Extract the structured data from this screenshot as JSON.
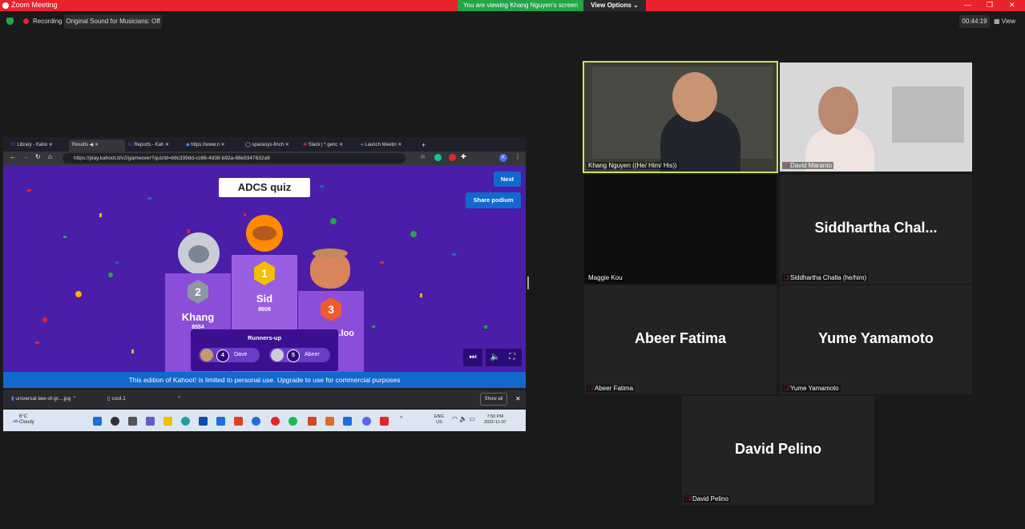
{
  "window": {
    "title": "Zoom Meeting",
    "viewing_banner": "You are viewing Khang Nguyen's screen",
    "view_options": "View Options ⌄",
    "controls": [
      "—",
      "❐",
      "✕"
    ]
  },
  "toolbar": {
    "recording": "Recording",
    "original_sound": "Original Sound for Musicians: Off",
    "timer": "00:44:19",
    "view": "View"
  },
  "browser": {
    "tabs": [
      "Library - Kaho",
      "Results",
      "Reports - Kah",
      "https://www.n",
      "spacesys-finch",
      "Slack | * genc",
      "Launch Meetin"
    ],
    "url": "https://play.kahoot.it/v2/gameover?quizId=b9c339dd-cc66-4d38-b92a-68e9347632a9",
    "new_tab": "+"
  },
  "kahoot": {
    "quiz_title": "ADCS quiz",
    "next": "Next",
    "share_podium": "Share podium",
    "podium": [
      {
        "rank": "2",
        "name": "Khang",
        "score": "8554"
      },
      {
        "rank": "1",
        "name": "Sid",
        "score": "8608"
      },
      {
        "rank": "3",
        "name": "...loo",
        "score": ""
      }
    ],
    "runners_up_title": "Runners-up",
    "runners_up": [
      {
        "rank": "4",
        "name": "Dave"
      },
      {
        "rank": "5",
        "name": "Abeer"
      }
    ],
    "banner": "This edition of Kahoot! is limited to personal use. Upgrade to use for commercial purposes"
  },
  "downloads": {
    "items": [
      "universal-law-of-gr....jpg",
      "cool.1"
    ],
    "show_all": "Show all"
  },
  "taskbar": {
    "temp": "6°C",
    "weather": "Cloudy",
    "lang": "ENG",
    "region": "US",
    "time": "7:50 PM",
    "date": "2022-11-07"
  },
  "participants": [
    {
      "name": "Khang Nguyen ((He/ Him/ His))",
      "display": "",
      "video": true
    },
    {
      "name": "David Maranto",
      "display": "",
      "video": true
    },
    {
      "name": "Maggie Kou",
      "display": "",
      "video": false
    },
    {
      "name": "Siddhartha Challa (he/him)",
      "display": "Siddhartha  Chal...",
      "video": false
    },
    {
      "name": "Abeer Fatima",
      "display": "Abeer Fatima",
      "video": false
    },
    {
      "name": "Yume Yamamoto",
      "display": "Yume Yamamoto",
      "video": false
    },
    {
      "name": "David Pelino",
      "display": "David Pelino",
      "video": false
    }
  ],
  "colors": {
    "zoom_red": "#e8232c",
    "banner_green": "#22a447",
    "kahoot_purple": "#4a1ea8",
    "kahoot_blue": "#1368ce",
    "active_speaker": "#c8e65a"
  }
}
